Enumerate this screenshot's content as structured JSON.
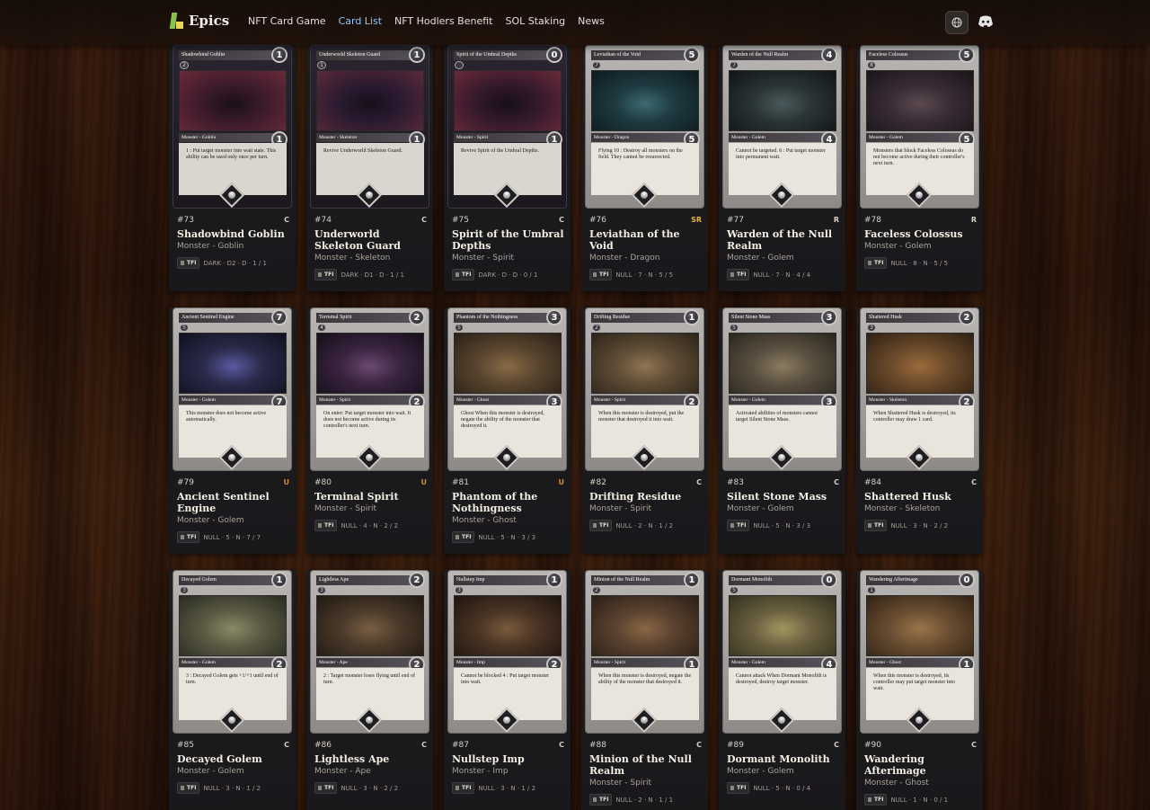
{
  "header": {
    "brand": "Epics",
    "nav": [
      {
        "label": "NFT Card Game",
        "active": false
      },
      {
        "label": "Card List",
        "active": true
      },
      {
        "label": "NFT Hodlers Benefit",
        "active": false
      },
      {
        "label": "SOL Staking",
        "active": false
      },
      {
        "label": "News",
        "active": false
      }
    ],
    "icons": [
      "globe-icon",
      "discord-icon"
    ]
  },
  "set_code": "TFI",
  "cards": [
    {
      "num": "#73",
      "name": "Shadowbind Goblin",
      "type": "Monster - Goblin",
      "rarity": "C",
      "stats": "DARK · D2 · D · 1 / 1",
      "cost": "1",
      "power": "1",
      "level": "2",
      "text": "1 : Put target monster into wait state. This ability can be used only once per turn.",
      "dark": true,
      "art": [
        "#3a1a2a",
        "#6b2a3a",
        "#1a1016"
      ]
    },
    {
      "num": "#74",
      "name": "Underworld Skeleton Guard",
      "type": "Monster - Skeleton",
      "rarity": "C",
      "stats": "DARK · D1 · D · 1 / 1",
      "cost": "1",
      "power": "1",
      "level": "1",
      "text": "Revive Underworld Skeleton Guard.",
      "dark": true,
      "art": [
        "#2a1a30",
        "#5a2a3a",
        "#160f1a"
      ]
    },
    {
      "num": "#75",
      "name": "Spirit of the Umbral Depths",
      "type": "Monster - Spirit",
      "rarity": "C",
      "stats": "DARK · D · D · 0 / 1",
      "cost": "0",
      "power": "1",
      "level": "",
      "text": "Revive Spirit of the Umbral Depths.",
      "dark": true,
      "art": [
        "#32182c",
        "#6a2a38",
        "#180f18"
      ]
    },
    {
      "num": "#76",
      "name": "Leviathan of the Void",
      "type": "Monster - Dragon",
      "rarity": "SR",
      "stats": "NULL · 7 · N · 5 / 5",
      "cost": "5",
      "power": "5",
      "level": "7",
      "text": "Flying 10 : Destroy all monsters on the field. They cannot be resurrected.",
      "dark": false,
      "art": [
        "#1e3a40",
        "#0c1a1e",
        "#3c6a70"
      ]
    },
    {
      "num": "#77",
      "name": "Warden of the Null Realm",
      "type": "Monster - Golem",
      "rarity": "R",
      "stats": "NULL · 7 · N · 4 / 4",
      "cost": "4",
      "power": "4",
      "level": "7",
      "text": "Cannot be targeted. 6 : Put target monster into permanent wait.",
      "dark": false,
      "art": [
        "#2a3436",
        "#101416",
        "#4a5a5c"
      ]
    },
    {
      "num": "#78",
      "name": "Faceless Colossus",
      "type": "Monster - Golem",
      "rarity": "R",
      "stats": "NULL · 8 · N · 5 / 5",
      "cost": "5",
      "power": "5",
      "level": "8",
      "text": "Monsters that block Faceless Colossus do not become active during their controller's next turn.",
      "dark": false,
      "art": [
        "#3a2c36",
        "#1a1418",
        "#5c4a50"
      ]
    },
    {
      "num": "#79",
      "name": "Ancient Sentinel Engine",
      "type": "Monster - Golem",
      "rarity": "U",
      "stats": "NULL · 5 · N · 7 / 7",
      "cost": "7",
      "power": "7",
      "level": "5",
      "text": "This monster does not become active automatically.",
      "dark": false,
      "art": [
        "#2a2a4a",
        "#10101e",
        "#5a5aa0"
      ]
    },
    {
      "num": "#80",
      "name": "Terminal Spirit",
      "type": "Monster - Spirit",
      "rarity": "U",
      "stats": "NULL · 4 · N · 2 / 2",
      "cost": "2",
      "power": "2",
      "level": "4",
      "text": "On enter: Put target monster into wait. It does not become active during its controller's next turn.",
      "dark": false,
      "art": [
        "#3a2440",
        "#140e18",
        "#6a4a70"
      ]
    },
    {
      "num": "#81",
      "name": "Phantom of the Nothingness",
      "type": "Monster - Ghost",
      "rarity": "U",
      "stats": "NULL · 5 · N · 3 / 3",
      "cost": "3",
      "power": "3",
      "level": "5",
      "text": "Ghost When this monster is destroyed, negate the ability of the monster that destroyed it.",
      "dark": false,
      "art": [
        "#5a4630",
        "#2a2016",
        "#8a6a44"
      ]
    },
    {
      "num": "#82",
      "name": "Drifting Residue",
      "type": "Monster - Spirit",
      "rarity": "C",
      "stats": "NULL · 2 · N · 1 / 2",
      "cost": "1",
      "power": "2",
      "level": "2",
      "text": "When this monster is destroyed, put the monster that destroyed it into wait.",
      "dark": false,
      "art": [
        "#5e4c36",
        "#2c2418",
        "#8e7452"
      ]
    },
    {
      "num": "#83",
      "name": "Silent Stone Mass",
      "type": "Monster - Golem",
      "rarity": "C",
      "stats": "NULL · 5 · N · 3 / 3",
      "cost": "3",
      "power": "3",
      "level": "5",
      "text": "Activated abilities of monsters cannot target Silent Stone Mass.",
      "dark": false,
      "art": [
        "#5a5040",
        "#2a261e",
        "#8a7c60"
      ]
    },
    {
      "num": "#84",
      "name": "Shattered Husk",
      "type": "Monster - Skeleton",
      "rarity": "C",
      "stats": "NULL · 3 · N · 2 / 2",
      "cost": "2",
      "power": "2",
      "level": "3",
      "text": "When Shattered Husk is destroyed, its controller may draw 1 card.",
      "dark": false,
      "art": [
        "#6a4a2a",
        "#2e2014",
        "#9a6a3a"
      ]
    },
    {
      "num": "#85",
      "name": "Decayed Golem",
      "type": "Monster - Golem",
      "rarity": "C",
      "stats": "NULL · 3 · N · 1 / 2",
      "cost": "1",
      "power": "2",
      "level": "3",
      "text": "3 : Decayed Golem gets +1/+1 until end of turn.",
      "dark": false,
      "art": [
        "#5a5a44",
        "#2a2a20",
        "#8a8a66"
      ]
    },
    {
      "num": "#86",
      "name": "Lightless Ape",
      "type": "Monster - Ape",
      "rarity": "C",
      "stats": "NULL · 3 · N · 2 / 2",
      "cost": "2",
      "power": "2",
      "level": "3",
      "text": "2 : Target monster loses flying until end of turn.",
      "dark": false,
      "art": [
        "#4a3a2a",
        "#201810",
        "#7a5e42"
      ]
    },
    {
      "num": "#87",
      "name": "Nullstep Imp",
      "type": "Monster - Imp",
      "rarity": "C",
      "stats": "NULL · 3 · N · 1 / 2",
      "cost": "1",
      "power": "2",
      "level": "3",
      "text": "Cannot be blocked 4 : Put target monster into wait.",
      "dark": false,
      "art": [
        "#4a3424",
        "#1e140e",
        "#7a5a3e"
      ]
    },
    {
      "num": "#88",
      "name": "Minion of the Null Realm",
      "type": "Monster - Spirit",
      "rarity": "C",
      "stats": "NULL · 2 · N · 1 / 1",
      "cost": "1",
      "power": "1",
      "level": "2",
      "text": "When this monster is destroyed, negate the ability of the monster that destroyed it.",
      "dark": false,
      "art": [
        "#5a4230",
        "#2a1e14",
        "#8a6644"
      ]
    },
    {
      "num": "#89",
      "name": "Dormant Monolith",
      "type": "Monster - Golem",
      "rarity": "C",
      "stats": "NULL · 5 · N · 0 / 4",
      "cost": "0",
      "power": "4",
      "level": "5",
      "text": "Cannot attack When Dormant Monolith is destroyed, destroy target monster.",
      "dark": false,
      "art": [
        "#6a6040",
        "#32301e",
        "#a09660"
      ]
    },
    {
      "num": "#90",
      "name": "Wandering Afterimage",
      "type": "Monster - Ghost",
      "rarity": "C",
      "stats": "NULL · 1 · N · 0 / 1",
      "cost": "0",
      "power": "1",
      "level": "1",
      "text": "When this monster is destroyed, its controller may put target monster into wait.",
      "dark": false,
      "art": [
        "#6a4e32",
        "#302214",
        "#9a7448"
      ]
    }
  ]
}
